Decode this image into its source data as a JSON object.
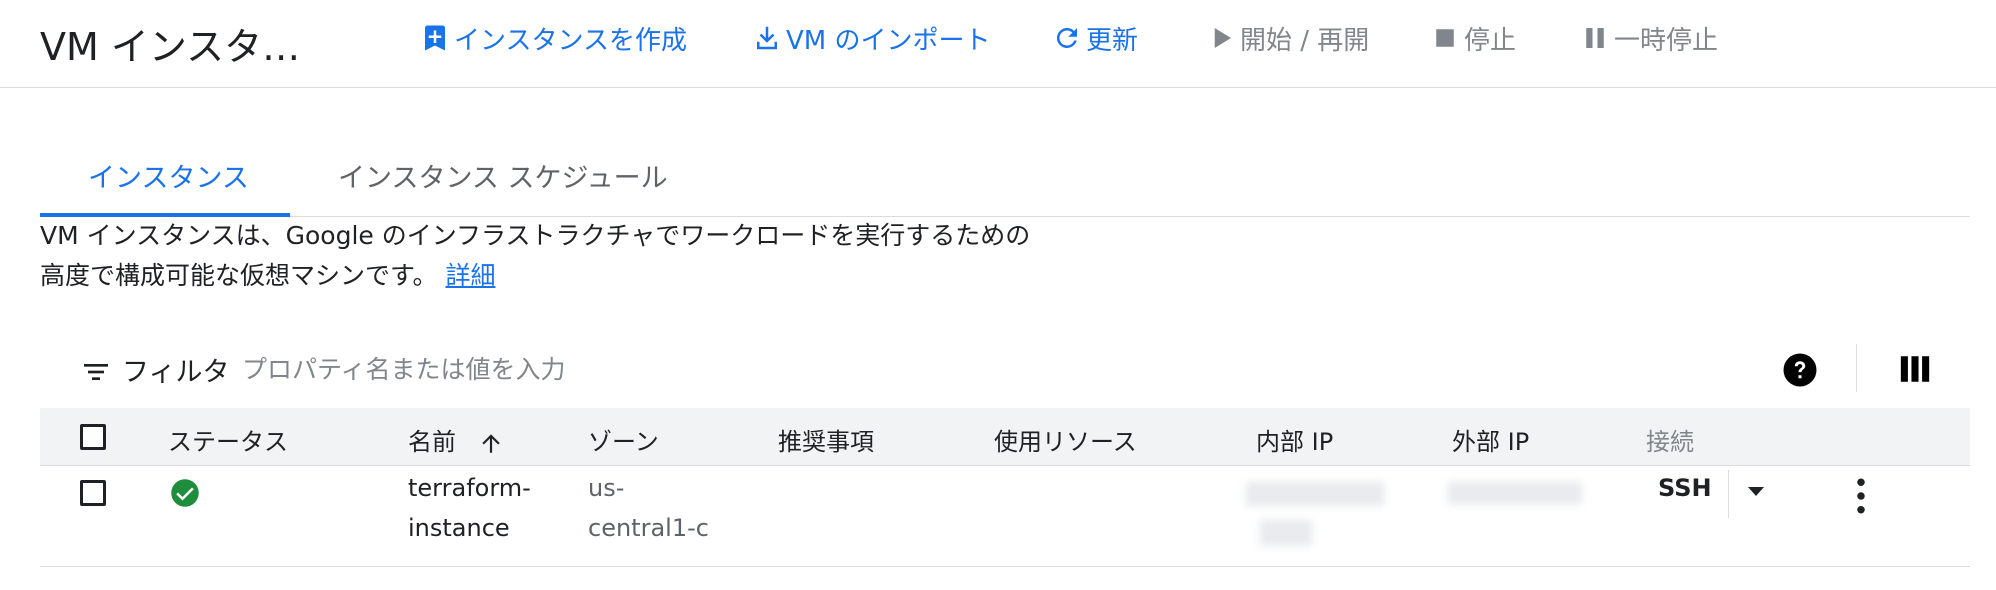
{
  "header": {
    "title": "VM インスタ…",
    "actions": [
      {
        "label": "インスタンスを作成",
        "icon": "add-box-icon",
        "state": "enabled"
      },
      {
        "label": "VM のインポート",
        "icon": "download-icon",
        "state": "enabled"
      },
      {
        "label": "更新",
        "icon": "refresh-icon",
        "state": "enabled"
      },
      {
        "label": "開始 / 再開",
        "icon": "play-icon",
        "state": "disabled"
      },
      {
        "label": "停止",
        "icon": "stop-icon",
        "state": "disabled"
      },
      {
        "label": "一時停止",
        "icon": "pause-icon",
        "state": "disabled"
      }
    ]
  },
  "tabs": [
    {
      "label": "インスタンス",
      "active": true
    },
    {
      "label": "インスタンス スケジュール",
      "active": false
    }
  ],
  "description": {
    "line1": "VM インスタンスは、Google のインフラストラクチャでワークロードを実行するための",
    "line2": "高度で構成可能な仮想マシンです。",
    "link": "詳細"
  },
  "filter": {
    "label": "フィルタ",
    "placeholder": "プロパティ名または値を入力"
  },
  "table": {
    "columns": [
      "ステータス",
      "名前",
      "ゾーン",
      "推奨事項",
      "使用リソース",
      "内部 IP",
      "外部 IP",
      "接続"
    ],
    "sort_column": "名前",
    "rows": [
      {
        "status": "running",
        "name_line1": "terraform-",
        "name_line2": "instance",
        "zone_line1": "us-",
        "zone_line2": "central1-c",
        "internal_ip": "",
        "external_ip": "",
        "connect": "SSH"
      }
    ]
  },
  "colors": {
    "accent": "#1a73e8",
    "status_ok": "#1e8e3e",
    "disabled": "#80868b"
  }
}
